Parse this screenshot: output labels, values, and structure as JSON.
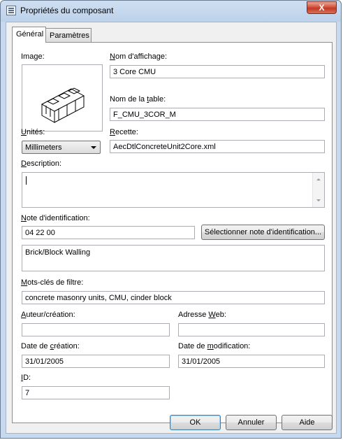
{
  "window": {
    "title": "Propriétés du composant",
    "close_label": "X"
  },
  "tabs": [
    {
      "label": "Général"
    },
    {
      "label": "Paramètres"
    }
  ],
  "labels": {
    "image": "Image:",
    "display_name": "Nom d'affichage:",
    "table_name": "Nom de la table:",
    "units": "Unités:",
    "recipe": "Recette:",
    "description": "Description:",
    "id_note": "Note d'identification:",
    "filter_keywords": "Mots-clés de filtre:",
    "author": "Auteur/création:",
    "web_address": "Adresse Web:",
    "creation_date": "Date de création:",
    "modification_date": "Date de modification:",
    "id": "ID:"
  },
  "values": {
    "display_name": "3 Core CMU",
    "table_name": "F_CMU_3COR_M",
    "units": "Millimeters",
    "recipe": "AecDtlConcreteUnit2Core.xml",
    "description": "",
    "id_note": "04 22 00",
    "id_note_text": "Brick/Block Walling",
    "filter_keywords": "concrete masonry units, CMU, cinder block",
    "author": "",
    "web_address": "",
    "creation_date": "31/01/2005",
    "modification_date": "31/01/2005",
    "id": "7"
  },
  "buttons": {
    "select_note": "Sélectionner note d'identification...",
    "ok": "OK",
    "cancel": "Annuler",
    "help": "Aide"
  },
  "icons": {
    "window_icon": "properties-icon",
    "preview": "cmu-block-icon",
    "dropdown": "chevron-down-icon"
  }
}
